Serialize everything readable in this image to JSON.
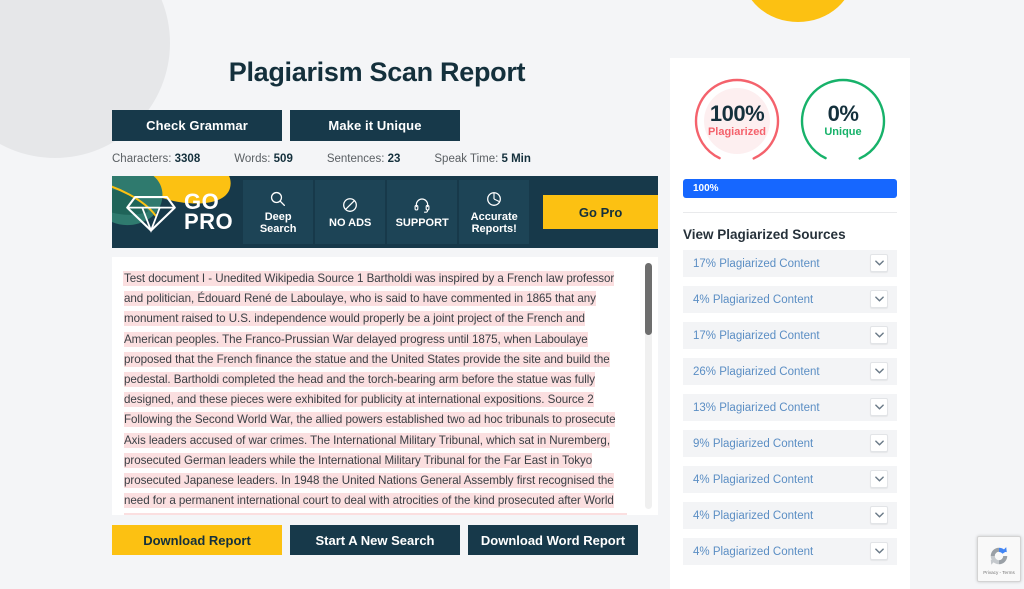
{
  "page": {
    "title": "Plagiarism Scan Report"
  },
  "toolbar": {
    "check_grammar_label": "Check Grammar",
    "make_unique_label": "Make it Unique"
  },
  "stats": [
    {
      "label": "Characters:",
      "value": "3308"
    },
    {
      "label": "Words:",
      "value": "509"
    },
    {
      "label": "Sentences:",
      "value": "23"
    },
    {
      "label": "Speak Time:",
      "value": "5 Min"
    }
  ],
  "gopro": {
    "brand_line1": "GO",
    "brand_line2": "PRO",
    "features": [
      {
        "icon": "magnifier-icon",
        "line1": "Deep",
        "line2": "Search"
      },
      {
        "icon": "no-ads-icon",
        "line1": "NO ADS",
        "line2": ""
      },
      {
        "icon": "headset-icon",
        "line1": "SUPPORT",
        "line2": ""
      },
      {
        "icon": "pie-chart-icon",
        "line1": "Accurate",
        "line2": "Reports!"
      }
    ],
    "cta_label": "Go Pro"
  },
  "document": {
    "segments": [
      {
        "text": " Test document I - Unedited Wikipedia Source 1  Bartholdi was inspired by a French law professor and politician, Édouard René de Laboulaye, who is said to have commented in 1865 that any monument raised to U.S.   independence would properly be a joint project of the French and American peoples.   The Franco-Prussian War delayed progress until 1875, when Laboulaye proposed that the French finance the statue and the United States provide the site and build the pedestal.   Bartholdi completed the head and the torch-bearing arm before the statue was fully designed, and these pieces were exhibited for publicity at international expositions.  Source 2  Following the Second World War, the allied powers established two ad hoc tribunals to prosecute Axis leaders accused of war crimes.   The International Military Tribunal, which sat in Nuremberg, prosecuted German leaders while the International Military Tribunal for the Far East in Tokyo prosecuted Japanese leaders.   In 1948 the United Nations General Assembly first recognised the need for a permanent international court to deal with atrocities of the kind prosecuted after World War II.  At the request of the General Assembly, the International Law Commission (ILC) drafted two statutes by "
      }
    ]
  },
  "bottom_buttons": {
    "download_report_label": "Download Report",
    "start_new_search_label": "Start A New Search",
    "download_word_report_label": "Download Word Report"
  },
  "report": {
    "plagiarized": {
      "percent": "100%",
      "word": "Plagiarized",
      "color": "#f4626c",
      "value": 100
    },
    "unique": {
      "percent": "0%",
      "word": "Unique",
      "color": "#17b26a",
      "value": 0
    },
    "progress": {
      "label": "100%",
      "value": 100,
      "color": "#1667ff"
    },
    "sources_title": "View Plagiarized Sources",
    "sources": [
      {
        "label": "17% Plagiarized Content"
      },
      {
        "label": "4% Plagiarized Content"
      },
      {
        "label": "17% Plagiarized Content"
      },
      {
        "label": "26% Plagiarized Content"
      },
      {
        "label": "13% Plagiarized Content"
      },
      {
        "label": "9% Plagiarized Content"
      },
      {
        "label": "4% Plagiarized Content"
      },
      {
        "label": "4% Plagiarized Content"
      },
      {
        "label": "4% Plagiarized Content"
      }
    ]
  },
  "recaptcha": {
    "terms": "Privacy - Terms"
  },
  "theme": {
    "dark": "#17394a",
    "yellow": "#fcc112",
    "blue": "#1667ff",
    "red": "#f4626c",
    "green": "#17b26a"
  }
}
